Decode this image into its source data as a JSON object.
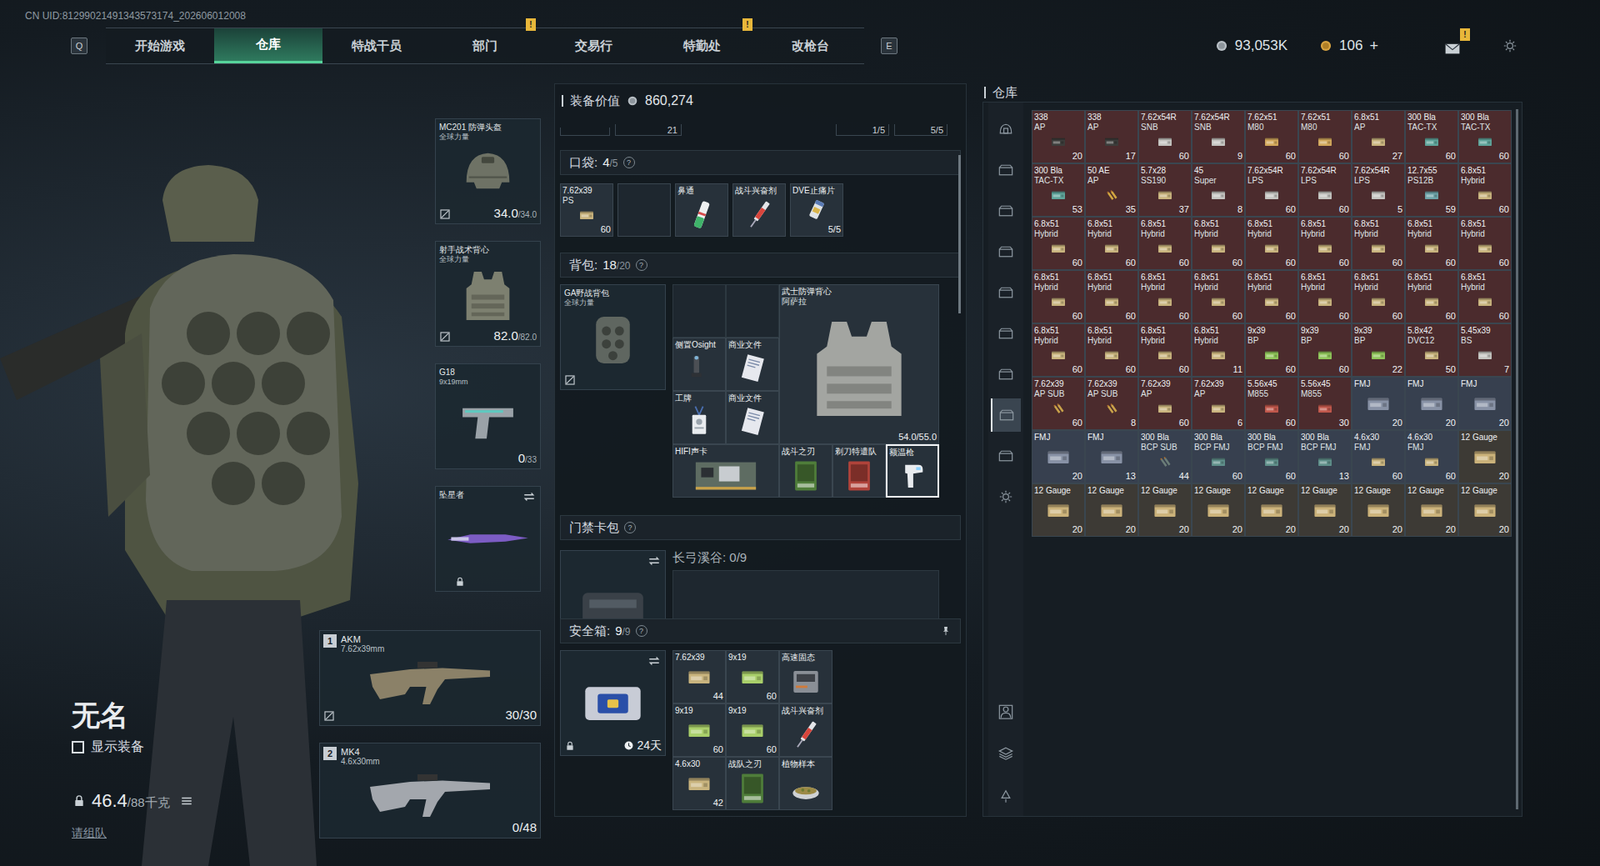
{
  "uid": "CN UID:81299021491343573174_202606012008",
  "nav": {
    "left_key": "Q",
    "right_key": "E",
    "badge_glyph": "!",
    "tabs": [
      {
        "label": "开始游戏",
        "selected": false,
        "badge": false
      },
      {
        "label": "仓库",
        "selected": true,
        "badge": false
      },
      {
        "label": "特战干员",
        "selected": false,
        "badge": false
      },
      {
        "label": "部门",
        "selected": false,
        "badge": true
      },
      {
        "label": "交易行",
        "selected": false,
        "badge": false
      },
      {
        "label": "特勤处",
        "selected": false,
        "badge": true
      },
      {
        "label": "改枪台",
        "selected": false,
        "badge": false
      }
    ]
  },
  "currency": {
    "coins": "93,053K",
    "tickets": "106",
    "add": "+",
    "mail_badge": "!"
  },
  "player": {
    "name": "无名",
    "show_equipment": {
      "label": "显示装备",
      "checked": false
    },
    "weight": "46.4",
    "weight_max": "/88千克",
    "team": "请组队"
  },
  "slots": [
    {
      "name": "MC201 防弹头盔",
      "sub": "全球力量",
      "value": "34.0",
      "max": "/34.0",
      "kind": "helmet",
      "uninsured": true,
      "locked": false,
      "swappable": false
    },
    {
      "name": "射手战术背心",
      "sub": "全球力量",
      "value": "82.0",
      "max": "/82.0",
      "kind": "vest",
      "uninsured": true,
      "locked": false,
      "swappable": false
    },
    {
      "name": "G18",
      "sub": "9x19mm",
      "value": "0",
      "max": "/33",
      "kind": "pistol",
      "uninsured": false,
      "locked": false,
      "swappable": false
    },
    {
      "name": "坠星者",
      "kind": "melee",
      "uninsured": false,
      "locked": true,
      "swappable": true
    }
  ],
  "weapons": [
    {
      "index": "1",
      "name": "AKM",
      "sub": "7.62x39mm",
      "value": "30/30",
      "kind": "rifle",
      "color": "#8b8168",
      "uninsured": true
    },
    {
      "index": "2",
      "name": "MK4",
      "sub": "4.6x30mm",
      "value": "0/48",
      "kind": "rifle",
      "color": "#a3a7ad",
      "uninsured": false
    }
  ],
  "loadout": {
    "value_label": "装备价值",
    "value": "860,274",
    "help": "?",
    "top_strip": [
      "21",
      "1/5",
      "5/5"
    ],
    "pockets": {
      "label": "口袋:",
      "count": "4",
      "max": "/5",
      "items": [
        {
          "name": "7.62x39",
          "sub": "PS",
          "count": "60",
          "kind": "box",
          "color": "#c9b47e"
        },
        {
          "kind": "empty"
        },
        {
          "name": "鼻通",
          "kind": "inhaler"
        },
        {
          "name": "战斗兴奋剂",
          "kind": "syringe"
        },
        {
          "name": "DVE止痛片",
          "count": "5/5",
          "kind": "pills"
        }
      ]
    },
    "backpack": {
      "label": "背包:",
      "count": "18",
      "max": "/20",
      "bag": {
        "name": "GA野战背包",
        "sub": "全球力量",
        "uninsured": true
      },
      "items": [
        {
          "name": "侧置Osight",
          "kind": "scope",
          "selected": false
        },
        {
          "name": "商业文件",
          "kind": "document",
          "selected": false
        },
        {
          "name": "工牌",
          "kind": "badge",
          "selected": false
        },
        {
          "name": "商业文件",
          "kind": "document",
          "selected": false
        },
        {
          "name": "HIFI声卡",
          "kind": "soundcard",
          "selected": false
        },
        {
          "name": "武士防弹背心",
          "sub": "阿萨拉",
          "count": "54.0/55.0",
          "kind": "vest",
          "color": "#a3a5a1",
          "selected": false
        },
        {
          "name": "战斗之刃",
          "kind": "card",
          "color": "#4f7d3a",
          "selected": false
        },
        {
          "name": "剃刀特遣队",
          "kind": "card",
          "color": "#b0433a",
          "selected": false
        },
        {
          "name": "额温枪",
          "kind": "thermometer",
          "selected": true
        }
      ]
    },
    "keycard": {
      "label": "门禁卡包",
      "area": "长弓溪谷: 0/9",
      "swappable": true
    },
    "safe": {
      "label": "安全箱:",
      "count": "9",
      "max": "/9",
      "days": "24天",
      "locked": true,
      "swappable": true,
      "items": [
        {
          "name": "7.62x39",
          "count": "44",
          "kind": "box",
          "color": "#c9b47e"
        },
        {
          "name": "9x19",
          "count": "60",
          "kind": "box",
          "color": "#a9cf6a"
        },
        {
          "name": "高速固态",
          "kind": "ssd"
        },
        {
          "name": "9x19",
          "count": "60",
          "kind": "box",
          "color": "#a9cf6a"
        },
        {
          "name": "9x19",
          "count": "60",
          "kind": "box",
          "color": "#a9cf6a"
        },
        {
          "name": "战斗兴奋剂",
          "kind": "syringe"
        },
        {
          "name": "4.6x30",
          "count": "42",
          "kind": "box",
          "color": "#c9b47e"
        },
        {
          "name": "战队之刃",
          "kind": "card",
          "color": "#4f7d3a"
        },
        {
          "name": "植物样本",
          "kind": "plant"
        }
      ]
    }
  },
  "warehouse": {
    "title": "仓库",
    "sidebar": [
      {
        "kind": "overview",
        "selected": false
      },
      {
        "kind": "box",
        "selected": false
      },
      {
        "kind": "box",
        "selected": false
      },
      {
        "kind": "box",
        "selected": false
      },
      {
        "kind": "box",
        "selected": false
      },
      {
        "kind": "box",
        "selected": false
      },
      {
        "kind": "box",
        "selected": false
      },
      {
        "kind": "box",
        "selected": true
      },
      {
        "kind": "box",
        "selected": false
      },
      {
        "kind": "gear",
        "selected": false
      }
    ],
    "sidebar_bottom": [
      {
        "kind": "person",
        "selected": false
      },
      {
        "kind": "layers",
        "selected": false
      },
      {
        "kind": "recycle",
        "selected": false
      }
    ],
    "items": [
      {
        "name": "338",
        "sub": "AP",
        "count": "20",
        "kind": "box",
        "color": "#3c3c3a",
        "cell": "#4b2b2d"
      },
      {
        "name": "338",
        "sub": "AP",
        "count": "17",
        "kind": "box",
        "color": "#3c3c3a",
        "cell": "#4b2b2d"
      },
      {
        "name": "7.62x54R",
        "sub": "SNB",
        "count": "60",
        "kind": "box",
        "color": "#c4c4c0",
        "cell": "#4b2b2d"
      },
      {
        "name": "7.62x54R",
        "sub": "SNB",
        "count": "9",
        "kind": "box",
        "color": "#c4c4c0",
        "cell": "#4b2b2d"
      },
      {
        "name": "7.62x51",
        "sub": "M80",
        "count": "60",
        "kind": "box",
        "color": "#d2a85c",
        "cell": "#4b2b2d"
      },
      {
        "name": "7.62x51",
        "sub": "M80",
        "count": "60",
        "kind": "box",
        "color": "#d2a85c",
        "cell": "#4b2b2d"
      },
      {
        "name": "6.8x51",
        "sub": "AP",
        "count": "27",
        "kind": "box",
        "color": "#c9b47e",
        "cell": "#4b2b2d"
      },
      {
        "name": "300 Bla",
        "sub": "TAC-TX",
        "count": "60",
        "kind": "box",
        "color": "#5fa49a",
        "cell": "#4b2b2d"
      },
      {
        "name": "300 Bla",
        "sub": "TAC-TX",
        "count": "60",
        "kind": "box",
        "color": "#5fa49a",
        "cell": "#4b2b2d"
      },
      {
        "name": "300 Bla",
        "sub": "TAC-TX",
        "count": "53",
        "kind": "box",
        "color": "#5fa49a",
        "cell": "#4b2b2d"
      },
      {
        "name": "50 AE",
        "sub": "AP",
        "count": "35",
        "kind": "bullet",
        "color": "#d1a640",
        "cell": "#4b2b2d"
      },
      {
        "name": "5.7x28",
        "sub": "SS190",
        "count": "37",
        "kind": "box",
        "color": "#c9b47e",
        "cell": "#4b2b2d"
      },
      {
        "name": "45",
        "sub": "Super",
        "count": "8",
        "kind": "box",
        "color": "#c4c4c0",
        "cell": "#4b2b2d"
      },
      {
        "name": "7.62x54R",
        "sub": "LPS",
        "count": "60",
        "kind": "box",
        "color": "#c4c4c0",
        "cell": "#4b2b2d"
      },
      {
        "name": "7.62x54R",
        "sub": "LPS",
        "count": "60",
        "kind": "box",
        "color": "#c4c4c0",
        "cell": "#4b2b2d"
      },
      {
        "name": "7.62x54R",
        "sub": "LPS",
        "count": "5",
        "kind": "box",
        "color": "#c4c4c0",
        "cell": "#4b2b2d"
      },
      {
        "name": "12.7x55",
        "sub": "PS12B",
        "count": "59",
        "kind": "box",
        "color": "#6ea3a8",
        "cell": "#4b2b2d"
      },
      {
        "name": "6.8x51",
        "sub": "Hybrid",
        "count": "60",
        "kind": "box",
        "color": "#c9b47e",
        "cell": "#4b2b2d"
      },
      {
        "name": "6.8x51",
        "sub": "Hybrid",
        "count": "60",
        "kind": "box",
        "color": "#c9b47e",
        "cell": "#4b2b2d"
      },
      {
        "name": "6.8x51",
        "sub": "Hybrid",
        "count": "60",
        "kind": "box",
        "color": "#c9b47e",
        "cell": "#4b2b2d"
      },
      {
        "name": "6.8x51",
        "sub": "Hybrid",
        "count": "60",
        "kind": "box",
        "color": "#c9b47e",
        "cell": "#4b2b2d"
      },
      {
        "name": "6.8x51",
        "sub": "Hybrid",
        "count": "60",
        "kind": "box",
        "color": "#c9b47e",
        "cell": "#4b2b2d"
      },
      {
        "name": "6.8x51",
        "sub": "Hybrid",
        "count": "60",
        "kind": "box",
        "color": "#c9b47e",
        "cell": "#4b2b2d"
      },
      {
        "name": "6.8x51",
        "sub": "Hybrid",
        "count": "60",
        "kind": "box",
        "color": "#c9b47e",
        "cell": "#4b2b2d"
      },
      {
        "name": "6.8x51",
        "sub": "Hybrid",
        "count": "60",
        "kind": "box",
        "color": "#c9b47e",
        "cell": "#4b2b2d"
      },
      {
        "name": "6.8x51",
        "sub": "Hybrid",
        "count": "60",
        "kind": "box",
        "color": "#c9b47e",
        "cell": "#4b2b2d"
      },
      {
        "name": "6.8x51",
        "sub": "Hybrid",
        "count": "60",
        "kind": "box",
        "color": "#c9b47e",
        "cell": "#4b2b2d"
      },
      {
        "name": "6.8x51",
        "sub": "Hybrid",
        "count": "60",
        "kind": "box",
        "color": "#c9b47e",
        "cell": "#4b2b2d"
      },
      {
        "name": "6.8x51",
        "sub": "Hybrid",
        "count": "60",
        "kind": "box",
        "color": "#c9b47e",
        "cell": "#4b2b2d"
      },
      {
        "name": "6.8x51",
        "sub": "Hybrid",
        "count": "60",
        "kind": "box",
        "color": "#c9b47e",
        "cell": "#4b2b2d"
      },
      {
        "name": "6.8x51",
        "sub": "Hybrid",
        "count": "60",
        "kind": "box",
        "color": "#c9b47e",
        "cell": "#4b2b2d"
      },
      {
        "name": "6.8x51",
        "sub": "Hybrid",
        "count": "60",
        "kind": "box",
        "color": "#c9b47e",
        "cell": "#4b2b2d"
      },
      {
        "name": "6.8x51",
        "sub": "Hybrid",
        "count": "60",
        "kind": "box",
        "color": "#c9b47e",
        "cell": "#4b2b2d"
      },
      {
        "name": "6.8x51",
        "sub": "Hybrid",
        "count": "60",
        "kind": "box",
        "color": "#c9b47e",
        "cell": "#4b2b2d"
      },
      {
        "name": "6.8x51",
        "sub": "Hybrid",
        "count": "60",
        "kind": "box",
        "color": "#c9b47e",
        "cell": "#4b2b2d"
      },
      {
        "name": "6.8x51",
        "sub": "Hybrid",
        "count": "60",
        "kind": "box",
        "color": "#c9b47e",
        "cell": "#4b2b2d"
      },
      {
        "name": "6.8x51",
        "sub": "Hybrid",
        "count": "60",
        "kind": "box",
        "color": "#c9b47e",
        "cell": "#4b2b2d"
      },
      {
        "name": "6.8x51",
        "sub": "Hybrid",
        "count": "60",
        "kind": "box",
        "color": "#c9b47e",
        "cell": "#4b2b2d"
      },
      {
        "name": "6.8x51",
        "sub": "Hybrid",
        "count": "60",
        "kind": "box",
        "color": "#c9b47e",
        "cell": "#4b2b2d"
      },
      {
        "name": "6.8x51",
        "sub": "Hybrid",
        "count": "11",
        "kind": "box",
        "color": "#c9b47e",
        "cell": "#4b2b2d"
      },
      {
        "name": "9x39",
        "sub": "BP",
        "count": "60",
        "kind": "box",
        "color": "#8fc45a",
        "cell": "#4b2b2d"
      },
      {
        "name": "9x39",
        "sub": "BP",
        "count": "60",
        "kind": "box",
        "color": "#8fc45a",
        "cell": "#4b2b2d"
      },
      {
        "name": "9x39",
        "sub": "BP",
        "count": "22",
        "kind": "box",
        "color": "#8fc45a",
        "cell": "#4b2b2d"
      },
      {
        "name": "5.8x42",
        "sub": "DVC12",
        "count": "50",
        "kind": "box",
        "color": "#c9b47e",
        "cell": "#4b2b2d"
      },
      {
        "name": "5.45x39",
        "sub": "BS",
        "count": "7",
        "kind": "box",
        "color": "#c4c4c0",
        "cell": "#4b2b2d"
      },
      {
        "name": "7.62x39",
        "sub": "AP SUB",
        "count": "60",
        "kind": "bullet",
        "color": "#c9a24a",
        "cell": "#4b2b2d"
      },
      {
        "name": "7.62x39",
        "sub": "AP SUB",
        "count": "8",
        "kind": "bullet",
        "color": "#c9a24a",
        "cell": "#4b2b2d"
      },
      {
        "name": "7.62x39",
        "sub": "AP",
        "count": "60",
        "kind": "box",
        "color": "#c9b47e",
        "cell": "#4b2b2d"
      },
      {
        "name": "7.62x39",
        "sub": "AP",
        "count": "6",
        "kind": "box",
        "color": "#c9b47e",
        "cell": "#4b2b2d"
      },
      {
        "name": "5.56x45",
        "sub": "M855",
        "count": "60",
        "kind": "box",
        "color": "#c0584c",
        "cell": "#4b2b2d"
      },
      {
        "name": "5.56x45",
        "sub": "M855",
        "count": "30",
        "kind": "box",
        "color": "#c0584c",
        "cell": "#4b2b2d"
      },
      {
        "name": "FMJ",
        "count": "20",
        "kind": "box",
        "color": "#8892a6",
        "cell": "#37404f"
      },
      {
        "name": "FMJ",
        "count": "20",
        "kind": "box",
        "color": "#8892a6",
        "cell": "#37404f"
      },
      {
        "name": "FMJ",
        "count": "20",
        "kind": "box",
        "color": "#8892a6",
        "cell": "#37404f"
      },
      {
        "name": "FMJ",
        "count": "20",
        "kind": "box",
        "color": "#8892a6",
        "cell": "#37404f"
      },
      {
        "name": "FMJ",
        "count": "13",
        "kind": "box",
        "color": "#8892a6",
        "cell": "#37404f"
      },
      {
        "name": "300 Bla",
        "sub": "BCP SUB",
        "count": "44",
        "kind": "bullet",
        "color": "#6b7d78",
        "cell": "#37404f"
      },
      {
        "name": "300 Bla",
        "sub": "BCP FMJ",
        "count": "60",
        "kind": "box",
        "color": "#5f8f8a",
        "cell": "#37404f"
      },
      {
        "name": "300 Bla",
        "sub": "BCP FMJ",
        "count": "60",
        "kind": "box",
        "color": "#5f8f8a",
        "cell": "#37404f"
      },
      {
        "name": "300 Bla",
        "sub": "BCP FMJ",
        "count": "13",
        "kind": "box",
        "color": "#5f8f8a",
        "cell": "#37404f"
      },
      {
        "name": "4.6x30",
        "sub": "FMJ",
        "count": "60",
        "kind": "box",
        "color": "#c9b47e",
        "cell": "#37404f"
      },
      {
        "name": "4.6x30",
        "sub": "FMJ",
        "count": "60",
        "kind": "box",
        "color": "#c9b47e",
        "cell": "#37404f"
      },
      {
        "name": "12 Gauge",
        "count": "20",
        "kind": "box",
        "color": "#cbb27a",
        "cell": "#3d3a35"
      },
      {
        "name": "12 Gauge",
        "count": "20",
        "kind": "box",
        "color": "#cbb27a",
        "cell": "#3d3a35"
      },
      {
        "name": "12 Gauge",
        "count": "20",
        "kind": "box",
        "color": "#cbb27a",
        "cell": "#3d3a35"
      },
      {
        "name": "12 Gauge",
        "count": "20",
        "kind": "box",
        "color": "#cbb27a",
        "cell": "#3d3a35"
      },
      {
        "name": "12 Gauge",
        "count": "20",
        "kind": "box",
        "color": "#cbb27a",
        "cell": "#3d3a35"
      },
      {
        "name": "12 Gauge",
        "count": "20",
        "kind": "box",
        "color": "#cbb27a",
        "cell": "#3d3a35"
      },
      {
        "name": "12 Gauge",
        "count": "20",
        "kind": "box",
        "color": "#cbb27a",
        "cell": "#3d3a35"
      },
      {
        "name": "12 Gauge",
        "count": "20",
        "kind": "box",
        "color": "#cbb27a",
        "cell": "#3d3a35"
      },
      {
        "name": "12 Gauge",
        "count": "20",
        "kind": "box",
        "color": "#cbb27a",
        "cell": "#3d3a35"
      },
      {
        "name": "12 Gauge",
        "count": "20",
        "kind": "box",
        "color": "#cbb27a",
        "cell": "#3d3a35"
      }
    ]
  }
}
